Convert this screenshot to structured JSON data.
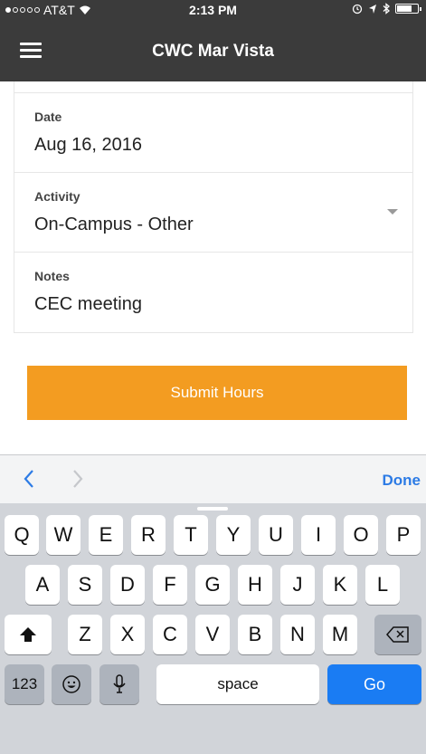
{
  "status_bar": {
    "carrier": "AT&T",
    "time": "2:13 PM"
  },
  "nav": {
    "title": "CWC Mar Vista"
  },
  "form": {
    "date": {
      "label": "Date",
      "value": "Aug 16, 2016"
    },
    "activity": {
      "label": "Activity",
      "value": "On-Campus - Other"
    },
    "notes": {
      "label": "Notes",
      "value": "CEC meeting"
    }
  },
  "submit_label": "Submit Hours",
  "accessory": {
    "done_label": "Done"
  },
  "keyboard": {
    "row1": [
      "Q",
      "W",
      "E",
      "R",
      "T",
      "Y",
      "U",
      "I",
      "O",
      "P"
    ],
    "row2": [
      "A",
      "S",
      "D",
      "F",
      "G",
      "H",
      "J",
      "K",
      "L"
    ],
    "row3": [
      "Z",
      "X",
      "C",
      "V",
      "B",
      "N",
      "M"
    ],
    "numbers_label": "123",
    "space_label": "space",
    "go_label": "Go"
  },
  "colors": {
    "nav_bar": "#3b3b3b",
    "submit_button": "#f39c21",
    "go_key": "#1a7cf3",
    "done_link": "#2c7be5"
  }
}
